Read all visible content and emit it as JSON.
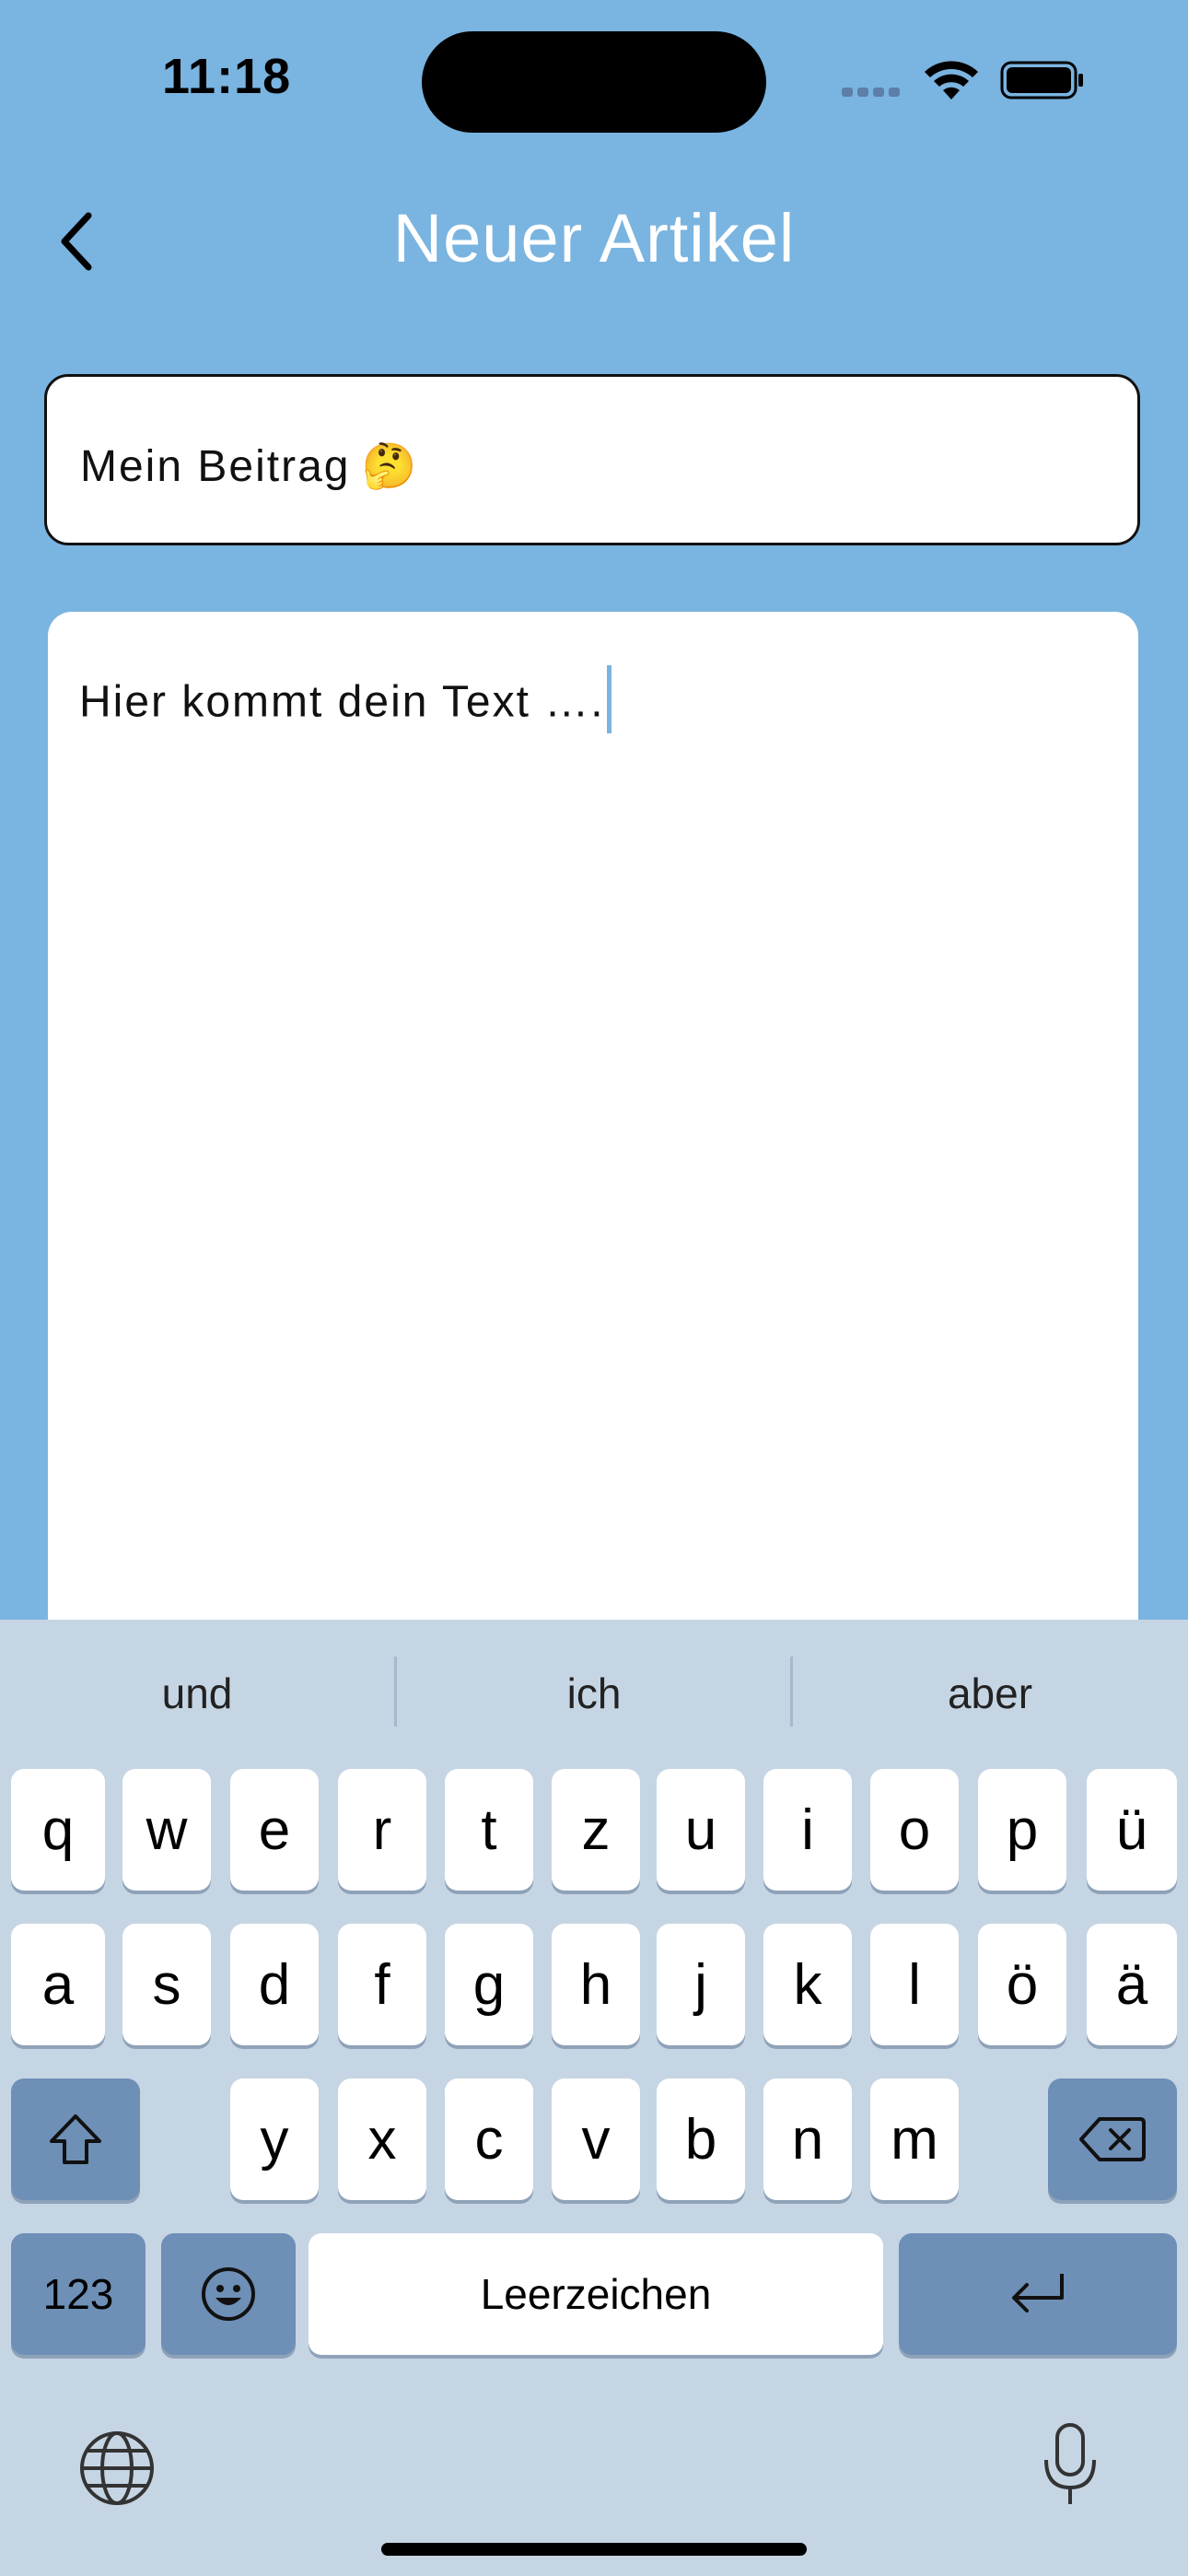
{
  "status_bar": {
    "time": "11:18"
  },
  "nav": {
    "title": "Neuer Artikel"
  },
  "form": {
    "title_value": "Mein Beitrag",
    "title_emoji": "🤔",
    "body_value": "Hier kommt dein Text …."
  },
  "keyboard": {
    "suggestions": [
      "und",
      "ich",
      "aber"
    ],
    "row1": [
      "q",
      "w",
      "e",
      "r",
      "t",
      "z",
      "u",
      "i",
      "o",
      "p",
      "ü"
    ],
    "row2": [
      "a",
      "s",
      "d",
      "f",
      "g",
      "h",
      "j",
      "k",
      "l",
      "ö",
      "ä"
    ],
    "row3": [
      "y",
      "x",
      "c",
      "v",
      "b",
      "n",
      "m"
    ],
    "numbers_label": "123",
    "space_label": "Leerzeichen"
  },
  "colors": {
    "background": "#7AB4E0",
    "keyboard_bg": "#C6D5E4",
    "special_key": "#6E8FB6",
    "caret": "#7AB4E0"
  },
  "icons": [
    "back-chevron-icon",
    "wifi-icon",
    "battery-icon",
    "shift-icon",
    "delete-icon",
    "emoji-icon",
    "return-icon",
    "globe-icon",
    "microphone-icon"
  ]
}
